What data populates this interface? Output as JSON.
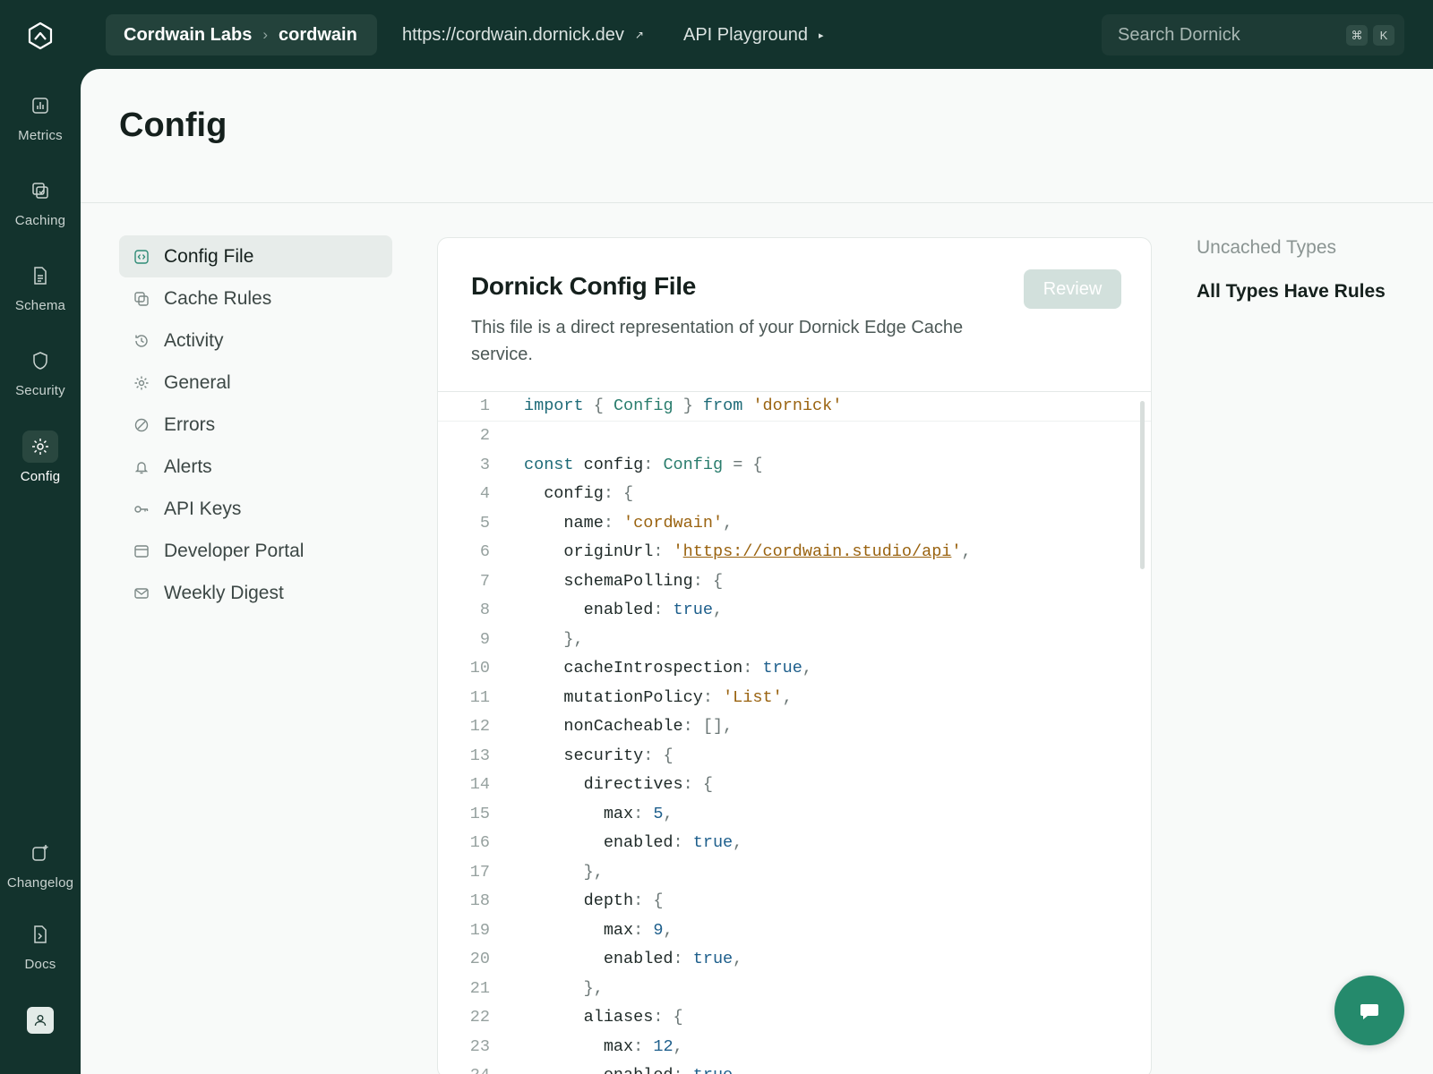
{
  "rail": {
    "items": [
      {
        "label": "Metrics",
        "icon": "bar-chart-icon"
      },
      {
        "label": "Caching",
        "icon": "layers-icon"
      },
      {
        "label": "Schema",
        "icon": "file-icon"
      },
      {
        "label": "Security",
        "icon": "shield-icon"
      },
      {
        "label": "Config",
        "icon": "gear-icon"
      },
      {
        "label": "Changelog",
        "icon": "changelog-icon"
      },
      {
        "label": "Docs",
        "icon": "docs-icon"
      }
    ],
    "active": "Config"
  },
  "topbar": {
    "org": "Cordwain Labs",
    "project": "cordwain",
    "url": "https://cordwain.dornick.dev",
    "url_icon": "↗",
    "playground": "API Playground",
    "playground_icon": "▸",
    "search_placeholder": "Search Dornick",
    "shortcut_keys": [
      "⌘",
      "K"
    ]
  },
  "page": {
    "title": "Config"
  },
  "settings_nav": {
    "items": [
      {
        "label": "Config File",
        "icon": "code-file-icon"
      },
      {
        "label": "Cache Rules",
        "icon": "layers-icon"
      },
      {
        "label": "Activity",
        "icon": "history-icon"
      },
      {
        "label": "General",
        "icon": "gear-icon"
      },
      {
        "label": "Errors",
        "icon": "slash-circle-icon"
      },
      {
        "label": "Alerts",
        "icon": "bell-icon"
      },
      {
        "label": "API Keys",
        "icon": "key-icon"
      },
      {
        "label": "Developer Portal",
        "icon": "window-icon"
      },
      {
        "label": "Weekly Digest",
        "icon": "mail-icon"
      }
    ],
    "active": "Config File"
  },
  "card": {
    "title": "Dornick Config File",
    "description": "This file is a direct representation of your Dornick Edge Cache service.",
    "review_label": "Review",
    "code_lines": [
      "import { Config } from 'dornick'",
      "",
      "const config: Config = {",
      "  config: {",
      "    name: 'cordwain',",
      "    originUrl: 'https://cordwain.studio/api',",
      "    schemaPolling: {",
      "      enabled: true,",
      "    },",
      "    cacheIntrospection: true,",
      "    mutationPolicy: 'List',",
      "    nonCacheable: [],",
      "    security: {",
      "      directives: {",
      "        max: 5,",
      "        enabled: true,",
      "      },",
      "      depth: {",
      "        max: 9,",
      "        enabled: true,",
      "      },",
      "      aliases: {",
      "        max: 12,",
      "        enabled: true,"
    ]
  },
  "aside": {
    "label": "Uncached Types",
    "value": "All Types Have Rules"
  },
  "chat": {
    "icon": "chat-bubble-icon"
  },
  "colors": {
    "rail_bg": "#13332d",
    "accent": "#258a6c",
    "review_disabled": "#d2e0dc",
    "string": "#9a6310",
    "keyword": "#1e6b78",
    "number": "#1e5f8c"
  }
}
